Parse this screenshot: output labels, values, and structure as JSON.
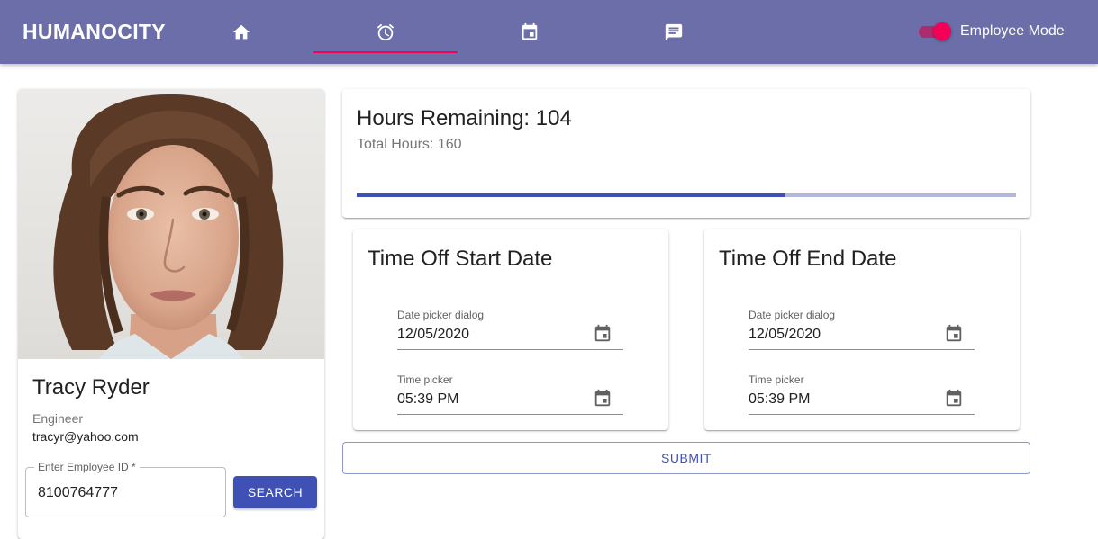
{
  "app": {
    "brand": "HUMANOCITY"
  },
  "nav": {
    "tabs": [
      {
        "icon": "home-icon",
        "active": false
      },
      {
        "icon": "alarm-clock-icon",
        "active": true
      },
      {
        "icon": "calendar-icon",
        "active": false
      },
      {
        "icon": "message-icon",
        "active": false
      }
    ],
    "mode_toggle": {
      "label": "Employee Mode",
      "on": true
    }
  },
  "profile": {
    "name": "Tracy Ryder",
    "role": "Engineer",
    "email": "tracyr@yahoo.com",
    "employee_id_label": "Enter Employee ID *",
    "employee_id_value": "8100764777",
    "search_label": "SEARCH"
  },
  "hours": {
    "title": "Hours Remaining: 104",
    "subtitle": "Total Hours: 160",
    "progress_fraction": 0.65
  },
  "start": {
    "title": "Time Off Start Date",
    "date_label": "Date picker dialog",
    "date_value": "12/05/2020",
    "time_label": "Time picker",
    "time_value": "05:39 PM"
  },
  "end": {
    "title": "Time Off End Date",
    "date_label": "Date picker dialog",
    "date_value": "12/05/2020",
    "time_label": "Time picker",
    "time_value": "05:39 PM"
  },
  "submit_label": "SUBMIT",
  "colors": {
    "appbar": "#6b6ea8",
    "primary": "#3f51b5",
    "accent": "#f50057"
  }
}
